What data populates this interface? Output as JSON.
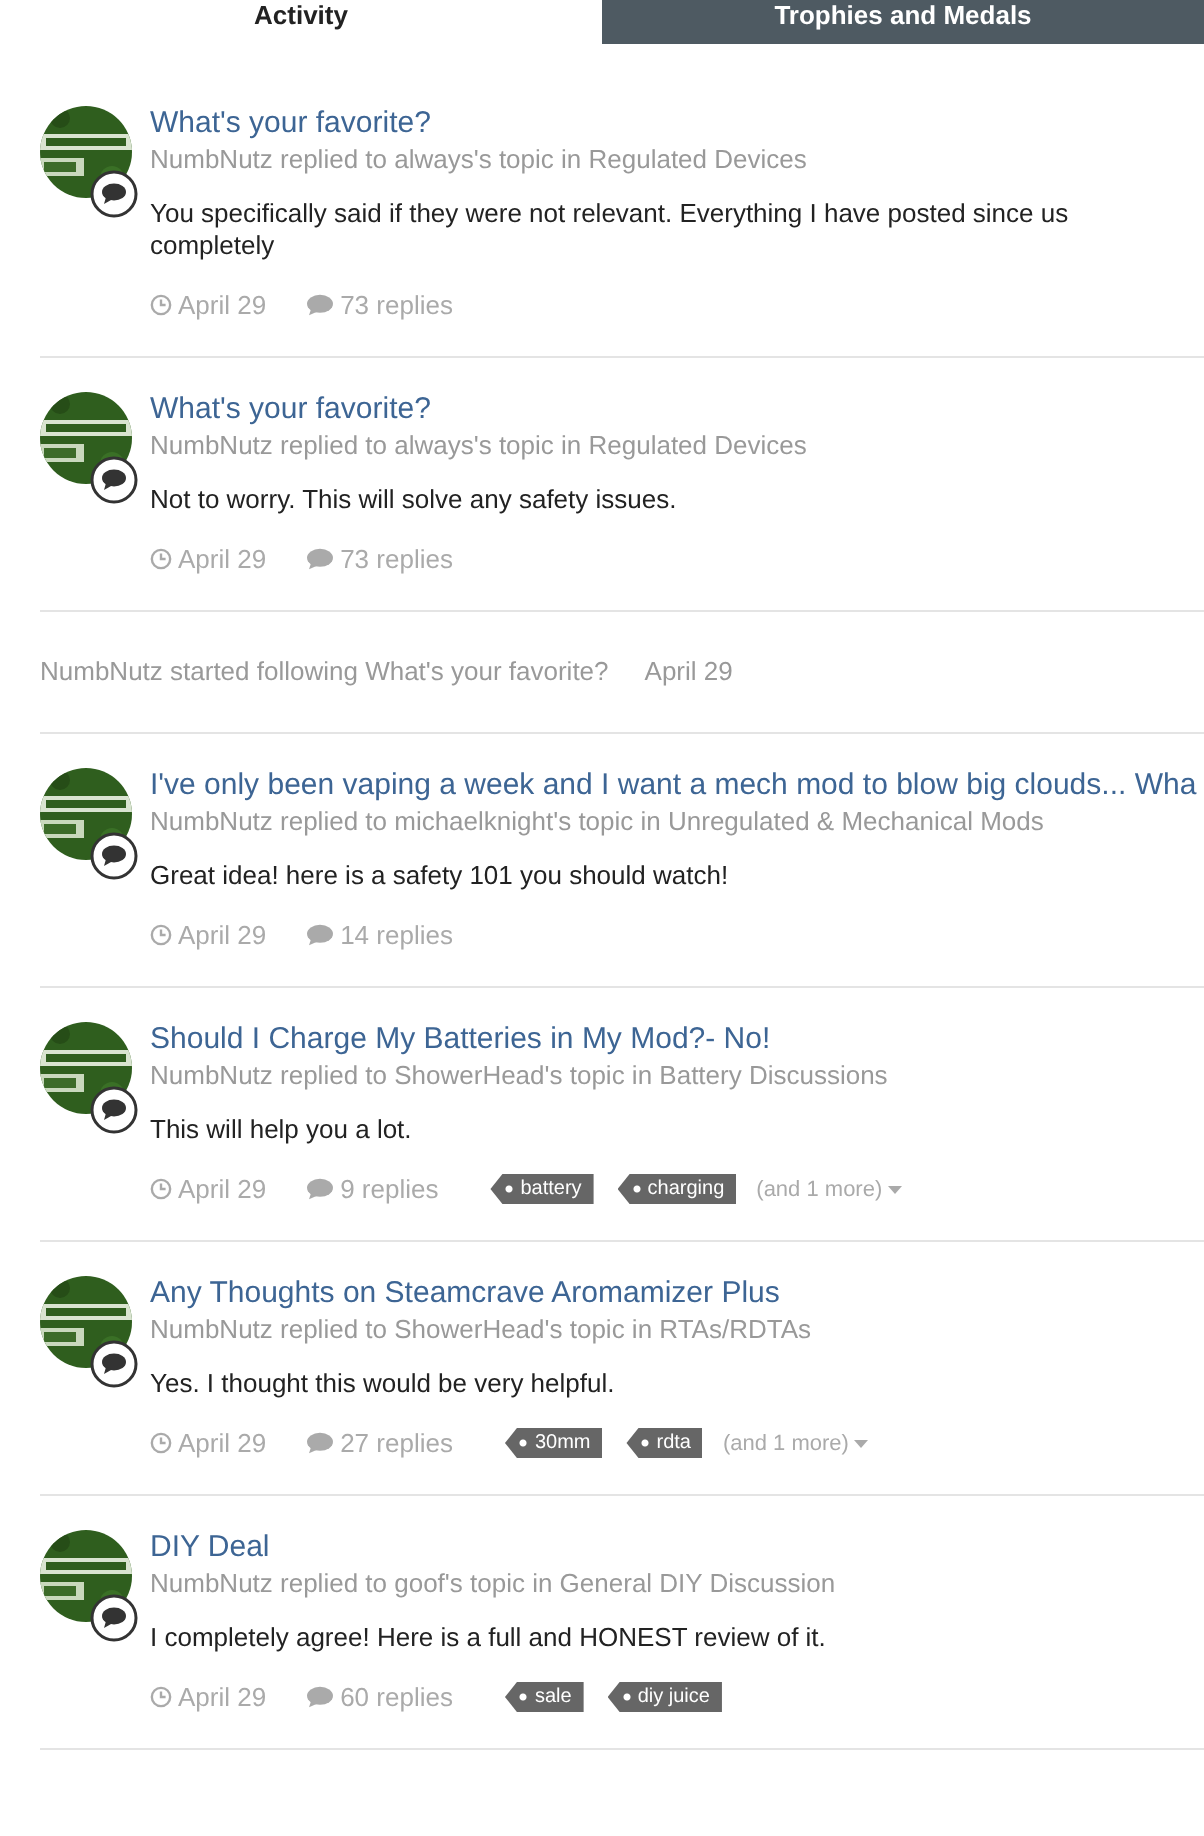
{
  "tabs": [
    {
      "label": "Activity",
      "selected": true
    },
    {
      "label": "Trophies and Medals",
      "selected": false
    }
  ],
  "feed": [
    {
      "kind": "post",
      "title": "What's your favorite?",
      "meta": "NumbNutz replied to always's topic in Regulated Devices",
      "snippet": "You specifically said if they were not relevant. Everything I have posted since us completely",
      "date": "April 29",
      "replies": "73 replies"
    },
    {
      "kind": "post",
      "title": "What's your favorite?",
      "meta": "NumbNutz replied to always's topic in Regulated Devices",
      "snippet": "Not to worry. This will solve any safety issues.",
      "date": "April 29",
      "replies": "73 replies"
    },
    {
      "kind": "follow",
      "text": "NumbNutz started following What's your favorite?",
      "date": "April 29"
    },
    {
      "kind": "post",
      "title": "I've only been vaping a week and I want a mech mod to blow big clouds... Wha",
      "meta": "NumbNutz replied to michaelknight's topic in Unregulated & Mechanical Mods",
      "snippet": "Great idea! here is a safety 101 you should watch!",
      "date": "April 29",
      "replies": "14 replies"
    },
    {
      "kind": "post",
      "title": "Should I Charge My Batteries in My Mod?- No!",
      "meta": "NumbNutz replied to ShowerHead's topic in Battery Discussions",
      "snippet": "This will help you a lot.",
      "date": "April 29",
      "replies": "9 replies",
      "tags": [
        "battery",
        "charging"
      ],
      "more": "(and 1 more)"
    },
    {
      "kind": "post",
      "title": "Any Thoughts on Steamcrave Aromamizer Plus",
      "meta": "NumbNutz replied to ShowerHead's topic in RTAs/RDTAs",
      "snippet": "Yes. I thought this would be very helpful.",
      "date": "April 29",
      "replies": "27 replies",
      "tags": [
        "30mm",
        "rdta"
      ],
      "more": "(and 1 more)"
    },
    {
      "kind": "post",
      "title": "DIY Deal",
      "meta": "NumbNutz replied to goof's topic in General DIY Discussion",
      "snippet": "I completely agree! Here is a full and HONEST review of it.",
      "date": "April 29",
      "replies": "60 replies",
      "tags": [
        "sale",
        "diy juice"
      ]
    }
  ]
}
